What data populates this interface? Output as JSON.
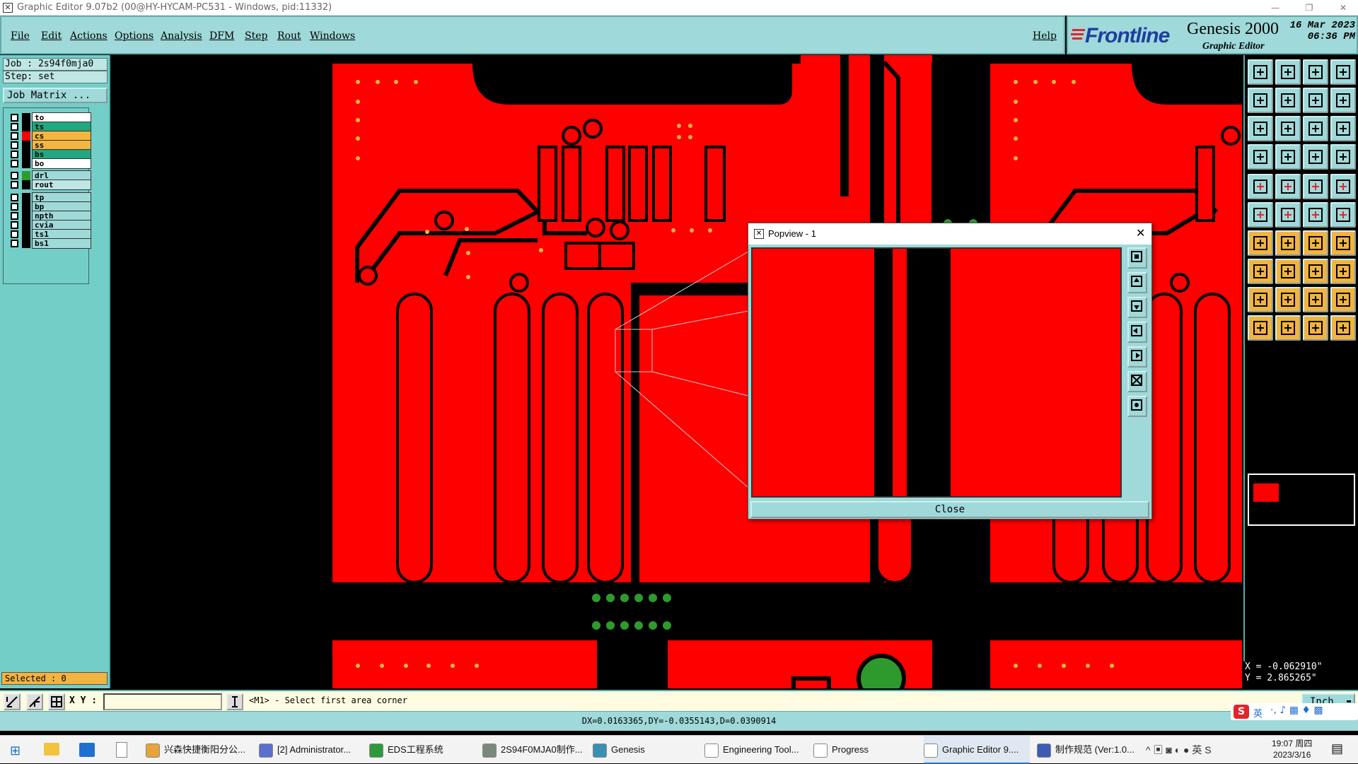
{
  "window": {
    "title": "Graphic Editor 9.07b2 (00@HY-HYCAM-PC531 - Windows, pid:11332)"
  },
  "menu": {
    "items": [
      "File",
      "Edit",
      "Actions",
      "Options",
      "Analysis",
      "DFM",
      "Step",
      "Rout",
      "Windows"
    ],
    "help": "Help"
  },
  "brand": {
    "frontline": "Frontline",
    "product": "Genesis 2000",
    "subtitle": "Graphic Editor",
    "date": "16 Mar 2023",
    "time": "06:36 PM"
  },
  "job": {
    "job_line": "Job : 2s94f0mja0",
    "step_line": "Step: set",
    "matrix_button": "Job Matrix ..."
  },
  "layers": [
    {
      "name": "to",
      "color": "#ffffff",
      "indicator": "#000000"
    },
    {
      "name": "ts",
      "color": "#1fa882",
      "indicator": "#000000"
    },
    {
      "name": "cs",
      "color": "#f4b63f",
      "indicator": "#ff0000"
    },
    {
      "name": "ss",
      "color": "#f4b63f",
      "indicator": "#000000"
    },
    {
      "name": "bs",
      "color": "#1fa882",
      "indicator": "#000000"
    },
    {
      "name": "bo",
      "color": "#ffffff",
      "indicator": "#000000"
    },
    {
      "name": "drl",
      "color": "#9fd9d9",
      "indicator": "#2e9a2e"
    },
    {
      "name": "rout",
      "color": "#bfe6e2",
      "indicator": "#000000"
    },
    {
      "name": "tp",
      "color": "#9fd9d9",
      "indicator": "#000000"
    },
    {
      "name": "bp",
      "color": "#9fd9d9",
      "indicator": "#000000"
    },
    {
      "name": "npth",
      "color": "#9fd9d9",
      "indicator": "#000000"
    },
    {
      "name": "cvia",
      "color": "#9fd9d9",
      "indicator": "#000000"
    },
    {
      "name": "ts1",
      "color": "#9fd9d9",
      "indicator": "#000000"
    },
    {
      "name": "bs1",
      "color": "#9fd9d9",
      "indicator": "#000000"
    }
  ],
  "selected_label": "Selected : 0",
  "popup": {
    "title": "Popview - 1",
    "close_label": "Close"
  },
  "coords": {
    "x": "X = -0.062910\"",
    "y": "Y = 2.865265\""
  },
  "command": {
    "xy_label": "X Y :",
    "xy_value": "",
    "prompt": "<M1> - Select first area corner",
    "units": "Inch"
  },
  "status": {
    "measure": "DX=0.0163365,DY=-0.0355143,D=0.0390914"
  },
  "taskbar": {
    "items": [
      {
        "label": "兴森快捷衡阳分公...",
        "color": "#e8a33b"
      },
      {
        "label": "[2] Administrator...",
        "color": "#5b6fd1"
      },
      {
        "label": "EDS工程系统",
        "color": "#2c9a3b"
      },
      {
        "label": "2S94F0MJA0制作...",
        "color": "#7a8a7a"
      },
      {
        "label": "Genesis",
        "color": "#3a8fb5"
      },
      {
        "label": "Engineering Tool...",
        "color": "#ffffff"
      },
      {
        "label": "Progress",
        "color": "#ffffff"
      },
      {
        "label": "Graphic Editor 9....",
        "color": "#ffffff"
      },
      {
        "label": "制作规范 (Ver:1.0...",
        "color": "#3b5bb5"
      }
    ],
    "ime": "英",
    "clock_time": "19:07 周四",
    "clock_date": "2023/3/16"
  },
  "colors": {
    "copper": "#ff0000",
    "drill": "#2e9a2e",
    "panel": "#9fd9d9",
    "accent_panel": "#73cec8"
  }
}
